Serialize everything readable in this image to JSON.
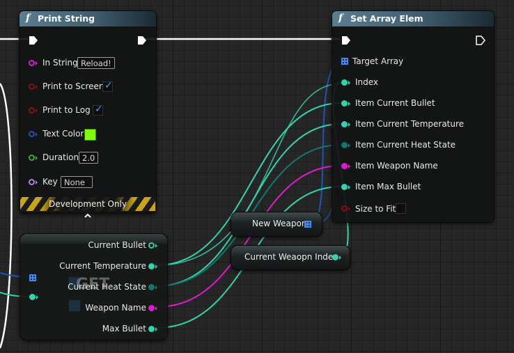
{
  "print_string": {
    "title": "Print String",
    "pins": {
      "in_string": {
        "label": "In String",
        "value": "Reload!"
      },
      "print_to_screen": {
        "label": "Print to Screen",
        "checked": true
      },
      "print_to_log": {
        "label": "Print to Log",
        "checked": true
      },
      "text_color": {
        "label": "Text Color",
        "value": "#7fff00"
      },
      "duration": {
        "label": "Duration",
        "value": "2.0"
      },
      "key": {
        "label": "Key",
        "value": "None"
      }
    },
    "dev_banner": "Development Only",
    "expand_icon": "chevron-up-icon"
  },
  "set_array_elem": {
    "title": "Set Array Elem",
    "pins": {
      "target_array": "Target Array",
      "index": "Index",
      "item_current_bullet": "Item Current Bullet",
      "item_current_temperature": "Item Current Temperature",
      "item_current_heat_state": "Item Current Heat State",
      "item_weapon_name": "Item Weapon Name",
      "item_max_bullet": "Item Max Bullet",
      "size_to_fit": "Size to Fit"
    }
  },
  "variables": {
    "new_weapon": "New Weapon",
    "current_weapon_index": "Current Weaopn Index"
  },
  "get_node": {
    "watermark": "GET",
    "pins": {
      "current_bullet": "Current Bullet",
      "current_temperature": "Current Temperature",
      "current_heat_state": "Current Heat State",
      "weapon_name": "Weapon Name",
      "max_bullet": "Max Bullet"
    }
  },
  "colors": {
    "int_pin": "#2fd6ad",
    "enum_pin": "#0e7a6e",
    "name_pin": "#e11ad2",
    "bool_pin": "#8b0f0f",
    "struct_pin": "#1b55b5",
    "float_pin": "#38b020",
    "key_pin": "#b080e8",
    "exec_pin": "#ffffff",
    "array_pin": "#3b8cff"
  }
}
